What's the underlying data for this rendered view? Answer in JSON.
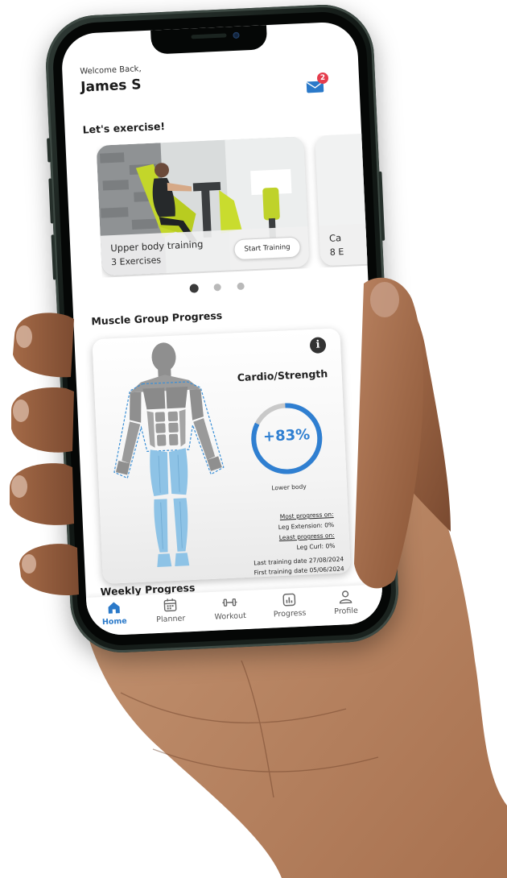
{
  "header": {
    "welcome": "Welcome Back,",
    "username": "James S",
    "mail_badge_count": "2"
  },
  "exercise": {
    "section_title": "Let's exercise!",
    "cards": [
      {
        "title": "Upper body training",
        "subtitle": "3 Exercises",
        "button": "Start Training"
      },
      {
        "title": "Ca",
        "subtitle": "8 E"
      }
    ],
    "pagination": {
      "total": 3,
      "active": 0
    }
  },
  "muscle_group": {
    "section_title": "Muscle Group Progress",
    "metric_title": "Cardio/Strength",
    "progress_value": "+83%",
    "progress_fraction": 0.83,
    "progress_caption": "Lower body",
    "most_progress_label": "Most progress on:",
    "most_progress_value": "Leg Extension: 0%",
    "least_progress_label": "Least progress on:",
    "least_progress_value": "Leg Curl: 0%",
    "last_training": "Last training date 27/08/2024",
    "first_training": "First training date 05/06/2024"
  },
  "weekly": {
    "section_title": "Weekly Progress"
  },
  "tabs": [
    {
      "label": "Home",
      "icon": "home-icon",
      "active": true
    },
    {
      "label": "Planner",
      "icon": "calendar-icon",
      "active": false
    },
    {
      "label": "Workout",
      "icon": "dumbbell-icon",
      "active": false
    },
    {
      "label": "Progress",
      "icon": "chart-icon",
      "active": false
    },
    {
      "label": "Profile",
      "icon": "person-icon",
      "active": false
    }
  ],
  "colors": {
    "accent": "#2a79c9",
    "ring": "#2f7fd1",
    "badge": "#e53d4d",
    "highlight_muscle": "#8ec3e6",
    "skin": "#8a5a3c"
  }
}
